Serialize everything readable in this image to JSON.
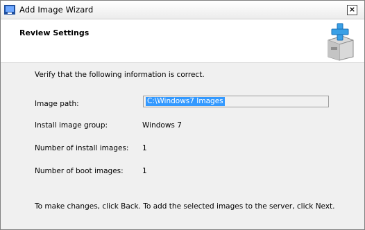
{
  "window": {
    "title": "Add Image Wizard",
    "close_glyph": "×"
  },
  "header": {
    "title": "Review Settings"
  },
  "main": {
    "intro": "Verify that the following information is correct.",
    "fields": {
      "image_path": {
        "label": "Image path:",
        "value": "C:\\Windows7 Images"
      },
      "install_group": {
        "label": "Install image group:",
        "value": "Windows 7"
      },
      "install_count": {
        "label": "Number of install images:",
        "value": "1"
      },
      "boot_count": {
        "label": "Number of boot images:",
        "value": "1"
      }
    },
    "footer_note": "To make changes, click Back. To add the selected images to the server, click Next."
  },
  "icons": {
    "app": "wds-app-icon",
    "wizard": "add-image-box-icon"
  },
  "colors": {
    "selection": "#3399ff",
    "plus": "#3aa0e6",
    "panel": "#f0f0f0"
  }
}
